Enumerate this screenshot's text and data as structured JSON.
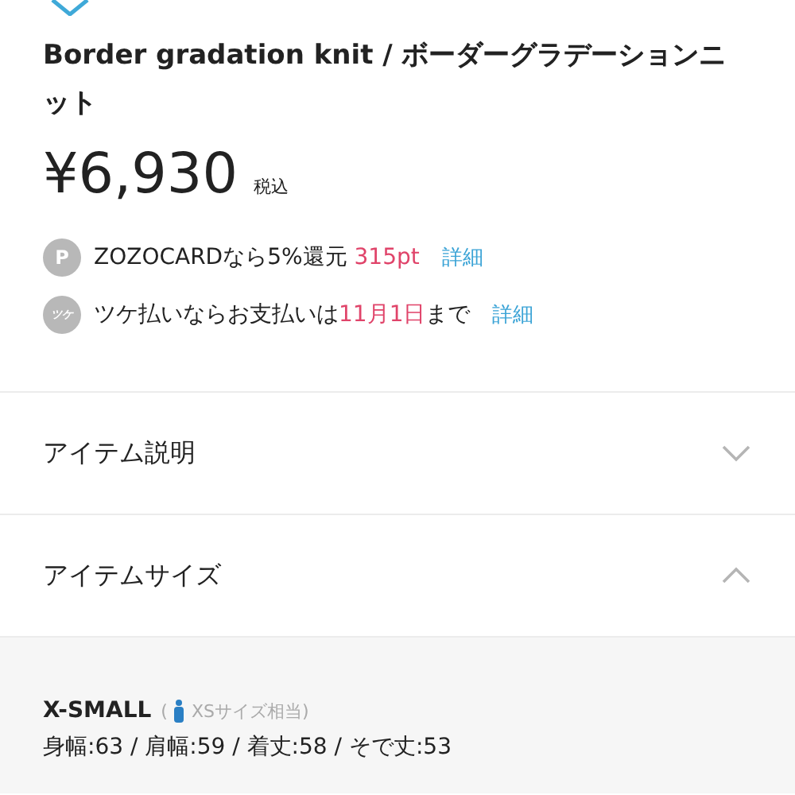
{
  "title": "Border gradation knit / ボーダーグラデーションニット",
  "price": {
    "amount": "¥6,930",
    "tax_note": "税込"
  },
  "benefits": [
    {
      "kind": "points",
      "badge": "P",
      "segments": [
        {
          "text": "ZOZOCARDなら5%還元 ",
          "highlight": false
        },
        {
          "text": "315pt",
          "highlight": true
        }
      ],
      "link": "詳細"
    },
    {
      "kind": "tsuke",
      "badge": "ツケ",
      "segments": [
        {
          "text": "ツケ払いならお支払いは",
          "highlight": false
        },
        {
          "text": "11月1日",
          "highlight": true
        },
        {
          "text": "まで",
          "highlight": false
        }
      ],
      "link": "詳細"
    }
  ],
  "sections": [
    {
      "label": "アイテム説明",
      "expanded": false
    },
    {
      "label": "アイテムサイズ",
      "expanded": true
    }
  ],
  "sizes": [
    {
      "name": "X-SMALL",
      "open": "(",
      "equivalent": "XSサイズ相当)",
      "measurements": "身幅:63 / 肩幅:59 / 着丈:58 / そで丈:53"
    }
  ]
}
